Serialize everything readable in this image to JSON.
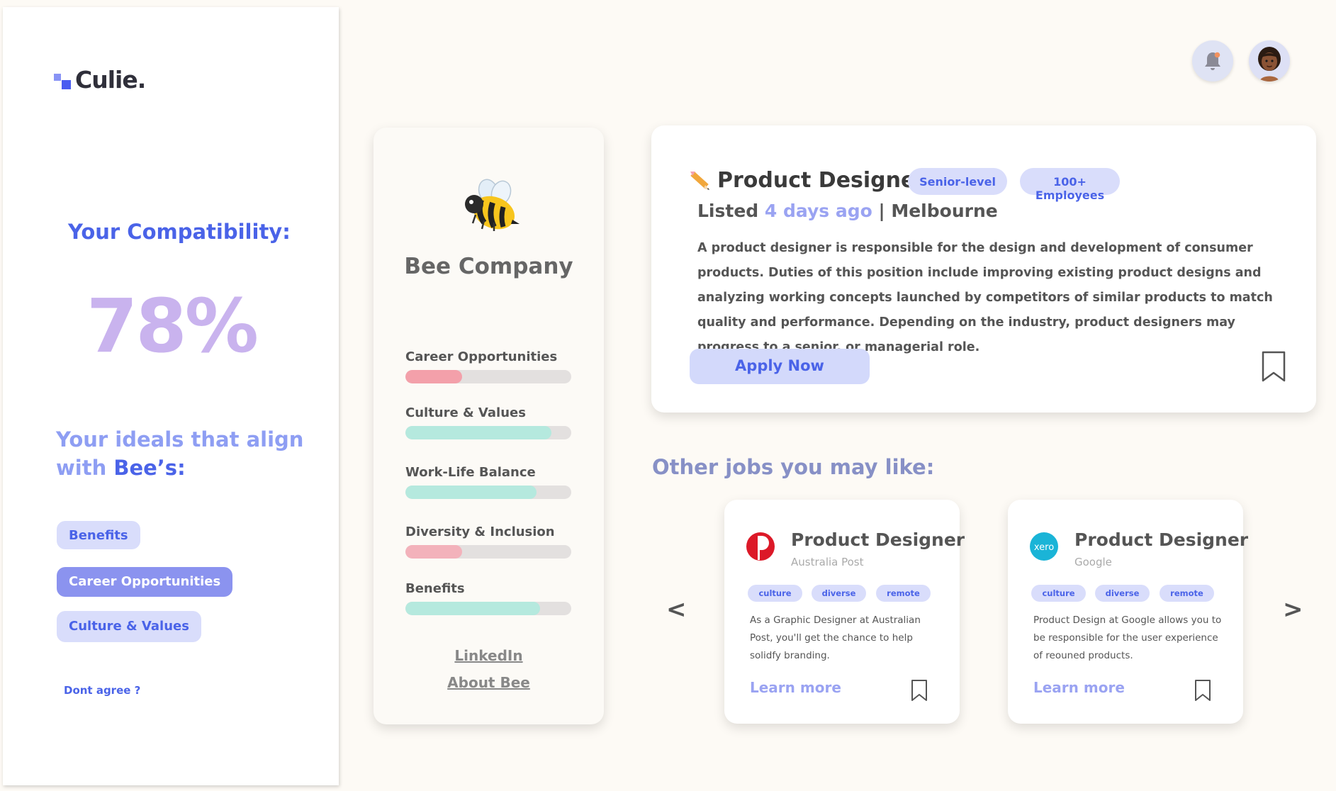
{
  "app": {
    "logo_text": "Culie."
  },
  "sidebar": {
    "compat_title": "Your Compatibility:",
    "compat_value": "78%",
    "ideals_prefix": "Your ideals that align with ",
    "ideals_company": "Bee’s",
    "ideals_suffix": ":",
    "pills": [
      {
        "label": "Benefits",
        "active": false
      },
      {
        "label": "Career Opportunities",
        "active": true
      },
      {
        "label": "Culture & Values",
        "active": false
      }
    ],
    "dont_agree": "Dont agree ?"
  },
  "header": {
    "bell_icon": "bell-icon",
    "avatar": "avatar"
  },
  "company": {
    "icon": "bee-icon",
    "name": "Bee Company",
    "ratings": [
      {
        "label": "Career Opportunities",
        "value": 0.34,
        "color": "#f3a0aa"
      },
      {
        "label": "Culture & Values",
        "value": 0.88,
        "color": "#b5e9de"
      },
      {
        "label": "Work-Life Balance",
        "value": 0.79,
        "color": "#b5e9de"
      },
      {
        "label": "Diversity & Inclusion",
        "value": 0.34,
        "color": "#f3b2bb"
      },
      {
        "label": "Benefits",
        "value": 0.81,
        "color": "#b5e9de"
      }
    ],
    "links": [
      "LinkedIn",
      "About Bee"
    ]
  },
  "job": {
    "icon": "pencil-icon",
    "title": "Product Designer",
    "badges": [
      "Senior-level",
      "100+ Employees"
    ],
    "listed_prefix": "Listed ",
    "listed_ago": "4 days ago",
    "listed_suffix": " | Melbourne",
    "description": "A product designer is responsible for the design and development of consumer products. Duties of this position include improving existing product designs and analyzing working concepts launched by competitors of similar products to match quality and performance. Depending on the industry, product designers may progress to a senior, or managerial role.",
    "apply_label": "Apply Now"
  },
  "other_jobs": {
    "title": "Other jobs you may like:",
    "prev": "<",
    "next": ">",
    "items": [
      {
        "title": "Product Designer",
        "company": "Australia Post",
        "logo": "australia-post-logo",
        "tags": [
          "culture",
          "diverse",
          "remote"
        ],
        "description": "As a Graphic Designer at Australian Post, you'll get the chance to help solidfy branding.",
        "learn_more": "Learn more"
      },
      {
        "title": "Product Designer",
        "company": "Google",
        "logo": "xero-logo",
        "logo_text": "xero",
        "tags": [
          "culture",
          "diverse",
          "remote"
        ],
        "description": "Product Design at Google allows you to be responsible for the user experience of reouned products.",
        "learn_more": "Learn more"
      }
    ]
  },
  "colors": {
    "accent": "#4a63e8",
    "accent_light": "#9aa3f2",
    "pill_bg": "#d9ddfb",
    "page_bg": "#fdfaf5"
  }
}
